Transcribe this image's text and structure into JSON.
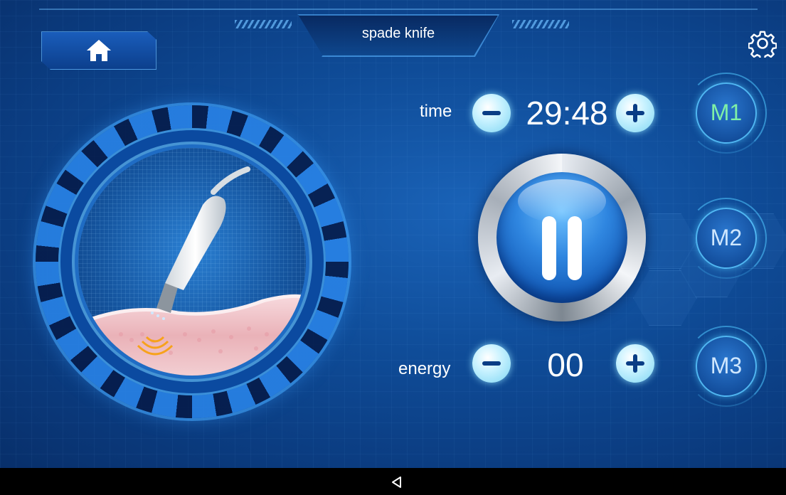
{
  "header": {
    "title": "spade knife",
    "home_icon": "home-icon",
    "settings_icon": "gear-icon"
  },
  "controls": {
    "time_label": "time",
    "time_value": "29:48",
    "energy_label": "energy",
    "energy_value": "00",
    "minus_icon": "minus-icon",
    "plus_icon": "plus-icon",
    "pause_icon": "pause-icon"
  },
  "modes": [
    {
      "label": "M1",
      "active": true
    },
    {
      "label": "M2",
      "active": false
    },
    {
      "label": "M3",
      "active": false
    }
  ],
  "navigation": {
    "back_icon": "back-triangle-icon"
  },
  "colors": {
    "background": "#0f4c98",
    "accent": "#7fd6f3",
    "active_mode_text": "#7ff0a6"
  }
}
